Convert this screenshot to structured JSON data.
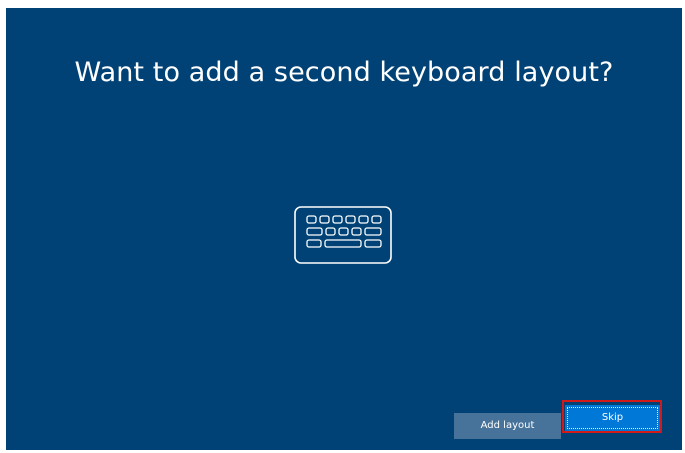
{
  "title": "Want to add a second keyboard layout?",
  "icon": "keyboard-icon",
  "buttons": {
    "add_layout_label": "Add layout",
    "skip_label": "Skip"
  },
  "colors": {
    "background": "#004275",
    "primary_button": "#0078d7",
    "secondary_button": "#47729a",
    "highlight": "#d21a1a"
  }
}
